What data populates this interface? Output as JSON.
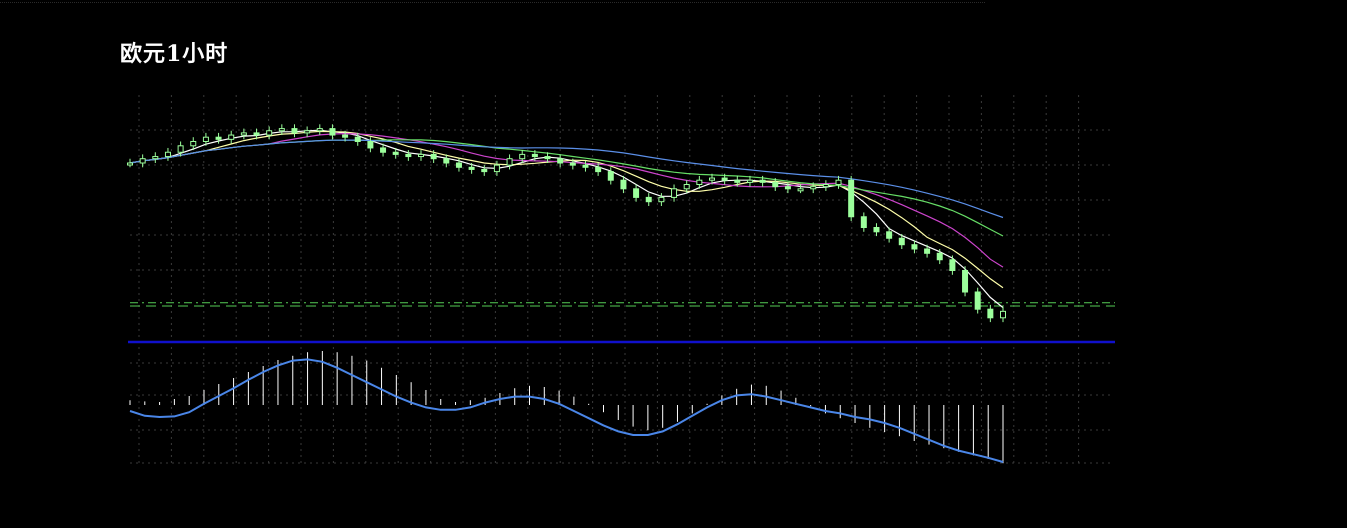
{
  "title": "欧元1小时",
  "colors": {
    "background": "#000000",
    "grid": "#3a3a3a",
    "candle_body": "#9cff9c",
    "candle_wick": "#9cff9c",
    "ma_fast": "#ffffff",
    "ma_mid1": "#ffffaa",
    "ma_mid2": "#cc44cc",
    "ma_slow1": "#66dd66",
    "ma_slow2": "#5b8fe8",
    "level_line": "#55cc55",
    "separator": "#1010cc",
    "histogram": "#ffffff",
    "signal": "#4a86e8"
  },
  "chart_data": [
    {
      "type": "candlestick",
      "title": "",
      "ylim": [
        0,
        1
      ],
      "grid": true,
      "close": [
        0.8,
        0.82,
        0.83,
        0.85,
        0.88,
        0.9,
        0.92,
        0.91,
        0.93,
        0.94,
        0.93,
        0.95,
        0.96,
        0.94,
        0.95,
        0.96,
        0.93,
        0.92,
        0.9,
        0.87,
        0.85,
        0.84,
        0.83,
        0.84,
        0.82,
        0.8,
        0.78,
        0.77,
        0.76,
        0.79,
        0.82,
        0.84,
        0.83,
        0.82,
        0.8,
        0.79,
        0.78,
        0.76,
        0.72,
        0.68,
        0.64,
        0.62,
        0.64,
        0.68,
        0.7,
        0.72,
        0.73,
        0.72,
        0.71,
        0.72,
        0.71,
        0.69,
        0.68,
        0.68,
        0.69,
        0.7,
        0.72,
        0.55,
        0.5,
        0.48,
        0.45,
        0.42,
        0.4,
        0.38,
        0.35,
        0.3,
        0.2,
        0.12,
        0.08,
        0.11
      ],
      "level_lines": [
        0.15,
        0.135
      ]
    },
    {
      "type": "histogram+line",
      "title": "",
      "ylim": [
        -1,
        1
      ],
      "grid": true,
      "histogram": [
        0.08,
        0.06,
        0.05,
        0.1,
        0.15,
        0.25,
        0.35,
        0.45,
        0.55,
        0.65,
        0.75,
        0.82,
        0.88,
        0.9,
        0.88,
        0.82,
        0.74,
        0.62,
        0.5,
        0.38,
        0.25,
        0.1,
        0.05,
        0.08,
        0.12,
        0.2,
        0.28,
        0.32,
        0.3,
        0.24,
        0.14,
        0.02,
        -0.12,
        -0.25,
        -0.36,
        -0.42,
        -0.38,
        -0.28,
        -0.14,
        0.02,
        0.16,
        0.27,
        0.34,
        0.32,
        0.24,
        0.12,
        -0.02,
        -0.14,
        -0.22,
        -0.3,
        -0.38,
        -0.45,
        -0.52,
        -0.6,
        -0.66,
        -0.72,
        -0.78,
        -0.84,
        -0.9,
        -0.97
      ],
      "signal": [
        -0.1,
        -0.18,
        -0.2,
        -0.19,
        -0.12,
        0.02,
        0.15,
        0.28,
        0.42,
        0.55,
        0.66,
        0.74,
        0.76,
        0.72,
        0.62,
        0.5,
        0.38,
        0.26,
        0.14,
        0.04,
        -0.04,
        -0.08,
        -0.08,
        -0.04,
        0.04,
        0.1,
        0.14,
        0.14,
        0.1,
        0.02,
        -0.1,
        -0.22,
        -0.34,
        -0.44,
        -0.5,
        -0.5,
        -0.44,
        -0.32,
        -0.18,
        -0.04,
        0.08,
        0.16,
        0.18,
        0.14,
        0.08,
        0.02,
        -0.04,
        -0.1,
        -0.14,
        -0.2,
        -0.24,
        -0.3,
        -0.38,
        -0.48,
        -0.58,
        -0.68,
        -0.76,
        -0.82,
        -0.88,
        -0.95
      ]
    }
  ]
}
